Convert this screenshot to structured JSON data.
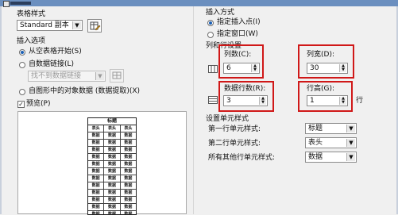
{
  "table_style": {
    "label": "表格样式",
    "value": "Standard 副本"
  },
  "insert_options": {
    "label": "插入选项",
    "from_empty": "从空表格开始(S)",
    "from_data_link": "自数据链接(L)",
    "data_link_placeholder": "找不到数据链接",
    "from_object_data": "自图形中的对象数据 (数据提取)(X)",
    "preview_label": "预览(P)",
    "preview_table_title": "标题",
    "preview_header": [
      "表头",
      "表头",
      "表头"
    ],
    "preview_cell": [
      "数据",
      "数据",
      "数据"
    ]
  },
  "insert_mode": {
    "label": "插入方式",
    "option_point": "指定插入点(I)",
    "option_window": "指定窗口(W)"
  },
  "rows_cols": {
    "label": "列和行设置",
    "columns_label": "列数(C):",
    "columns_value": "6",
    "col_width_label": "列宽(D):",
    "col_width_value": "30",
    "data_rows_label": "数据行数(R):",
    "data_rows_value": "3",
    "row_height_label": "行高(G):",
    "row_height_value": "1",
    "row_unit": "行"
  },
  "cell_styles": {
    "label": "设置单元样式",
    "first_row_label": "第一行单元样式:",
    "first_row_value": "标题",
    "second_row_label": "第二行单元样式:",
    "second_row_value": "表头",
    "other_rows_label": "所有其他行单元样式:",
    "other_rows_value": "数据"
  },
  "colors": {
    "highlight": "#d01818",
    "accent": "#1a5fb4"
  }
}
